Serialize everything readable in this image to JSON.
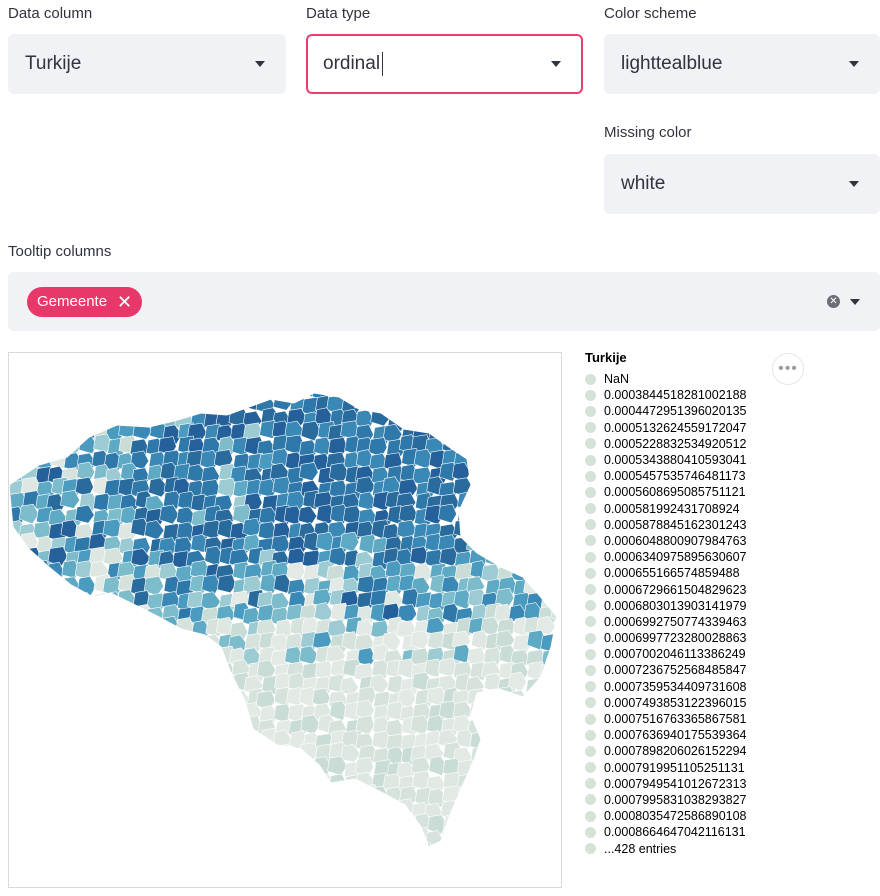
{
  "controls": {
    "data_column": {
      "label": "Data column",
      "value": "Turkije"
    },
    "data_type": {
      "label": "Data type",
      "value": "ordinal"
    },
    "color_scheme": {
      "label": "Color scheme",
      "value": "lighttealblue"
    },
    "missing_color": {
      "label": "Missing color",
      "value": "white"
    },
    "tooltip_columns": {
      "label": "Tooltip columns",
      "tags": [
        "Gemeente"
      ]
    }
  },
  "legend": {
    "title": "Turkije",
    "entries": [
      "NaN",
      "0.0003844518281002188",
      "0.0004472951396020135",
      "0.0005132624559172047",
      "0.0005228832534920512",
      "0.0005343880410593041",
      "0.0005457535746481173",
      "0.0005608695085751121",
      "0.000581992431708924",
      "0.0005878845162301243",
      "0.0006048800907984763",
      "0.0006340975895630607",
      "0.000655166574859488",
      "0.0006729661504829623",
      "0.0006803013903141979",
      "0.0006992750774339463",
      "0.0006997723280028863",
      "0.0007002046113386249",
      "0.0007236752568485847",
      "0.0007359534409731608",
      "0.0007493853122396015",
      "0.0007516763365867581",
      "0.0007636940175539364",
      "0.0007898206026152294",
      "0.0007919951105251131",
      "0.0007949541012672313",
      "0.0007995831038293827",
      "0.0008035472586890108",
      "0.0008664647042116131",
      "...428 entries"
    ],
    "dot_color": "#d5e3d7"
  },
  "colors": {
    "accent": "#e8386a",
    "input_bg": "#f0f2f6",
    "map_light": "#dde6e1",
    "map_mid": "#6fb3c7",
    "map_dark": "#2a6f9e"
  },
  "icons": {
    "more": "ellipsis-icon",
    "dropdown": "chevron-down-icon",
    "remove": "close-icon"
  }
}
